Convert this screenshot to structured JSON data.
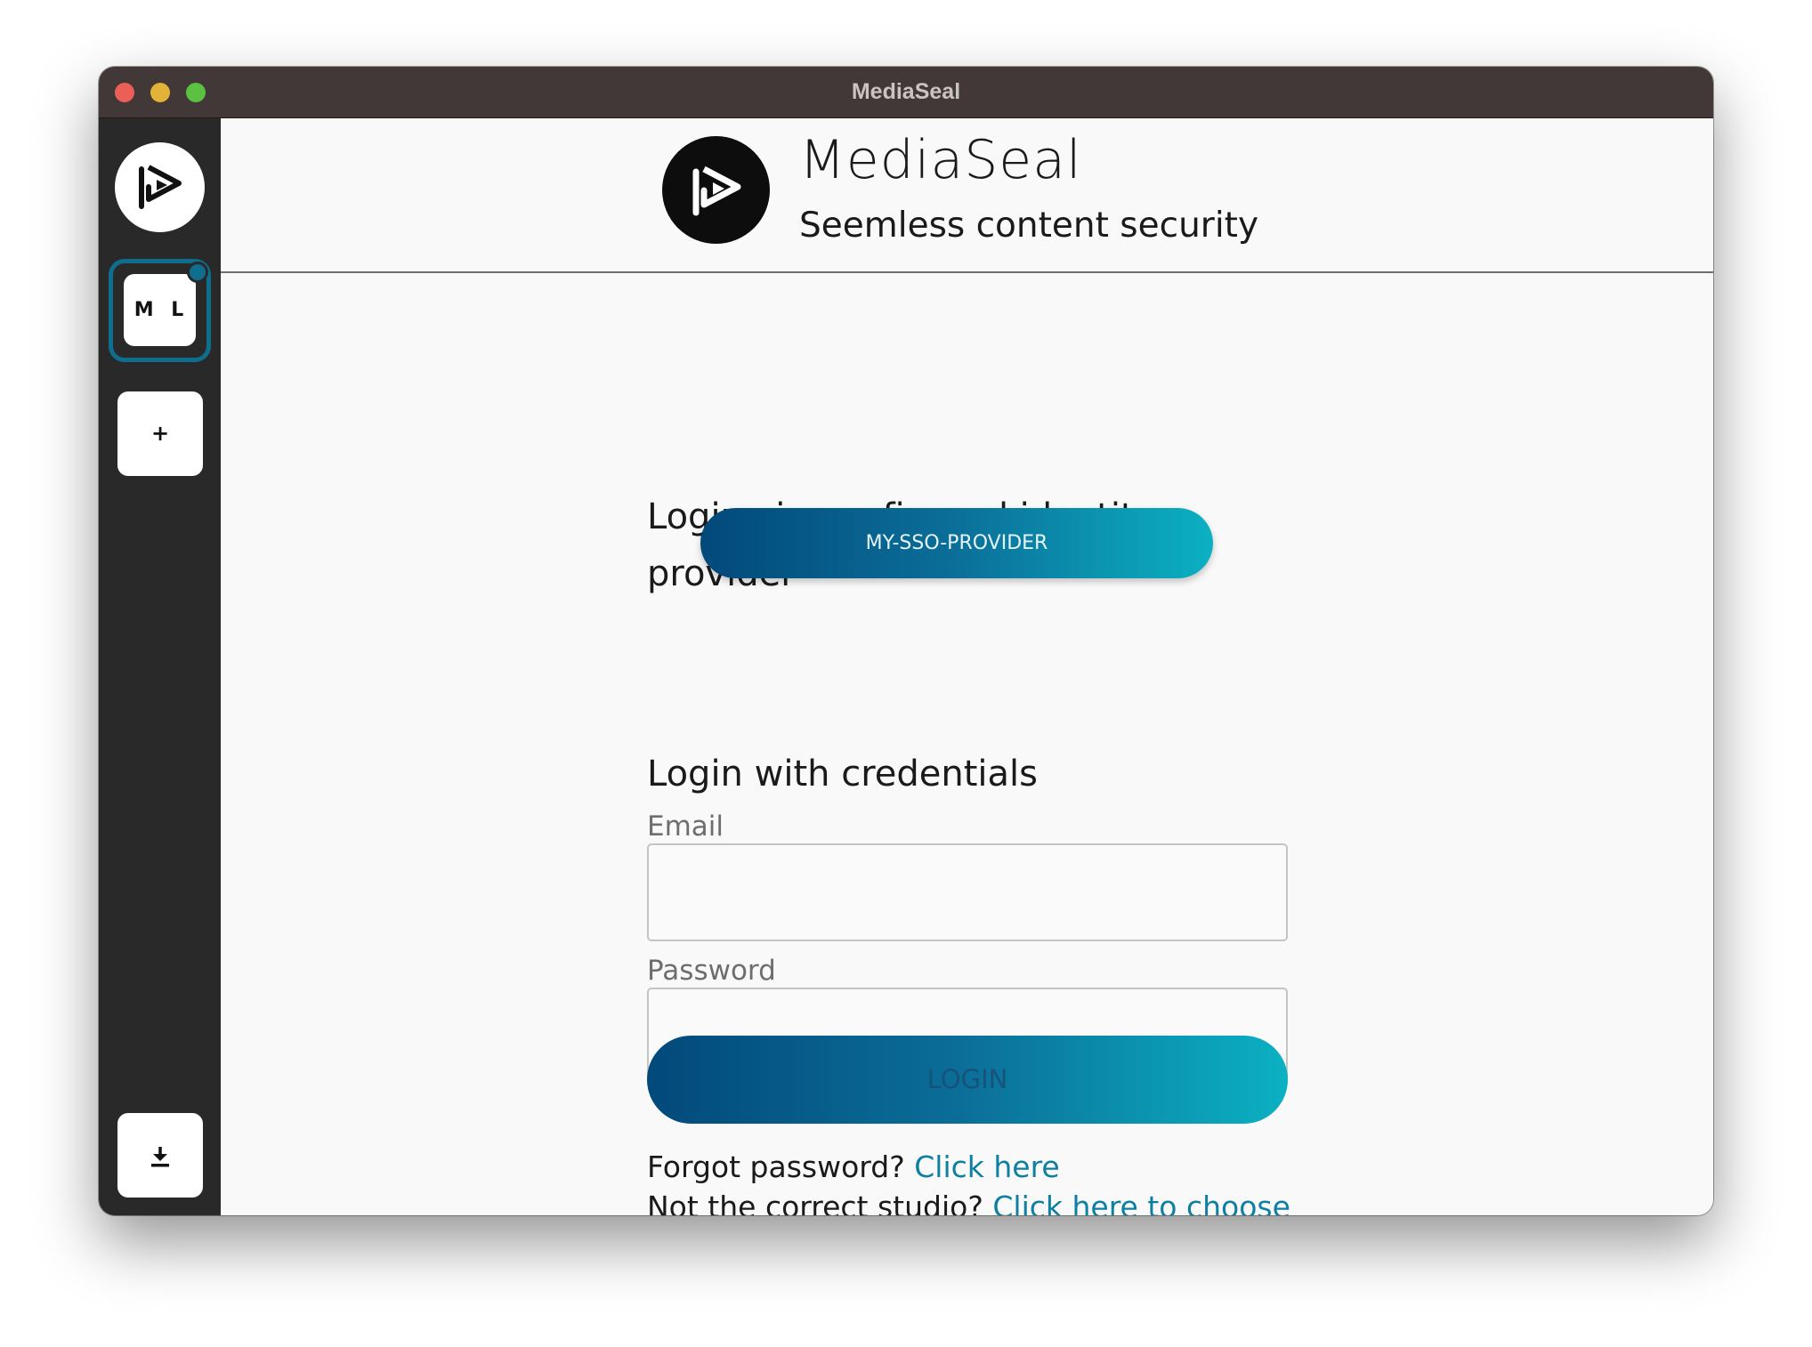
{
  "window": {
    "title": "MediaSeal"
  },
  "sidebar": {
    "studio_initials": "M L",
    "add_label": "+",
    "logo_icon": "mediaseal-logo-icon",
    "download_icon": "download-icon",
    "accent_color": "#0e6e8e"
  },
  "header": {
    "brand_name": "MediaSeal",
    "tagline": "Seemless content security"
  },
  "login": {
    "sso_heading": "Login via configured identity provider",
    "sso_button": "MY-SSO-PROVIDER",
    "credentials_heading": "Login with credentials",
    "email_label": "Email",
    "email_value": "",
    "password_label": "Password",
    "password_value": "",
    "login_button": "LOGIN",
    "forgot_text": "Forgot password?",
    "forgot_link": "Click here",
    "studio_text": "Not the correct studio?",
    "studio_link": "Click here to choose"
  },
  "colors": {
    "gradient_start": "#02497a",
    "gradient_end": "#0bb1c2",
    "link": "#0d7fa0"
  }
}
